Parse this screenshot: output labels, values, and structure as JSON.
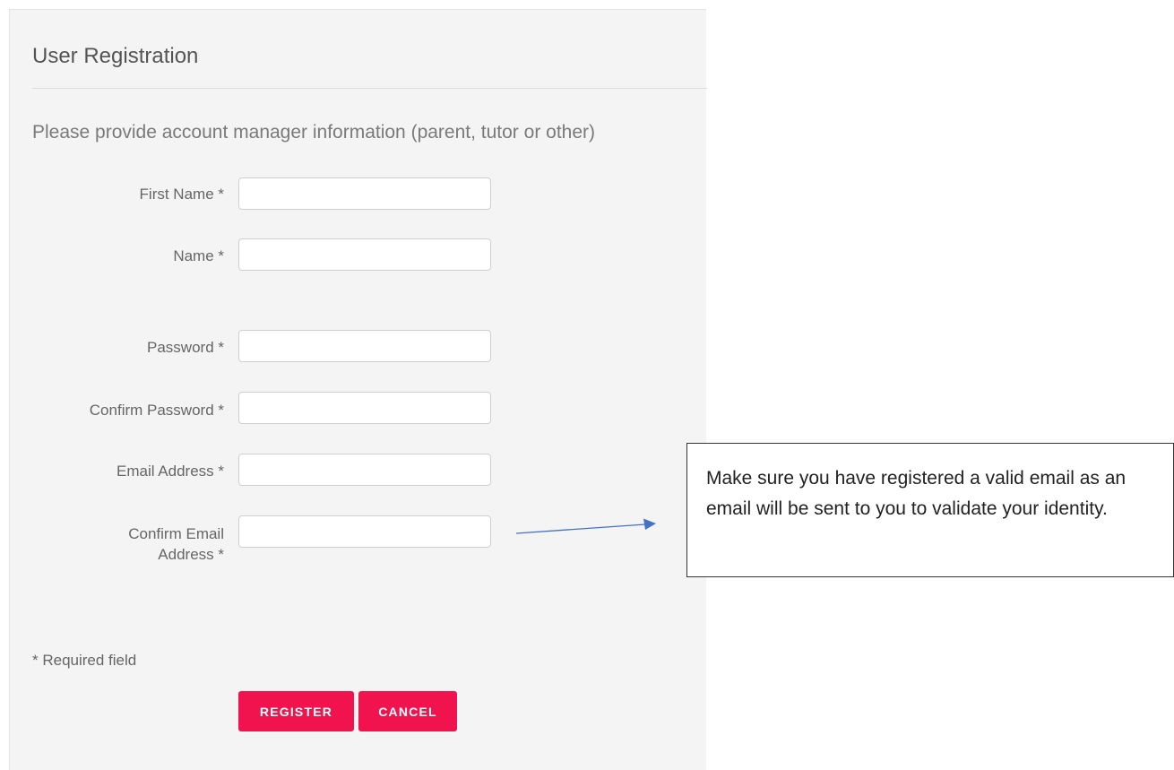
{
  "form": {
    "title": "User Registration",
    "subtitle": "Please provide account manager information (parent, tutor or other)",
    "fields": {
      "first_name": {
        "label": "First Name *",
        "value": ""
      },
      "name": {
        "label": "Name *",
        "value": ""
      },
      "password": {
        "label": "Password *",
        "value": ""
      },
      "confirm_password": {
        "label": "Confirm Password *",
        "value": ""
      },
      "email": {
        "label": "Email Address *",
        "value": ""
      },
      "confirm_email": {
        "label_line1": "Confirm Email",
        "label_line2": "Address *",
        "value": ""
      }
    },
    "required_note": "* Required field",
    "register_label": "REGISTER",
    "cancel_label": "CANCEL",
    "accent_color": "#f0134d"
  },
  "callout": {
    "text": "Make sure you have registered a valid email as an email will be sent to you to validate your identity.",
    "arrow_color": "#4472c4"
  }
}
